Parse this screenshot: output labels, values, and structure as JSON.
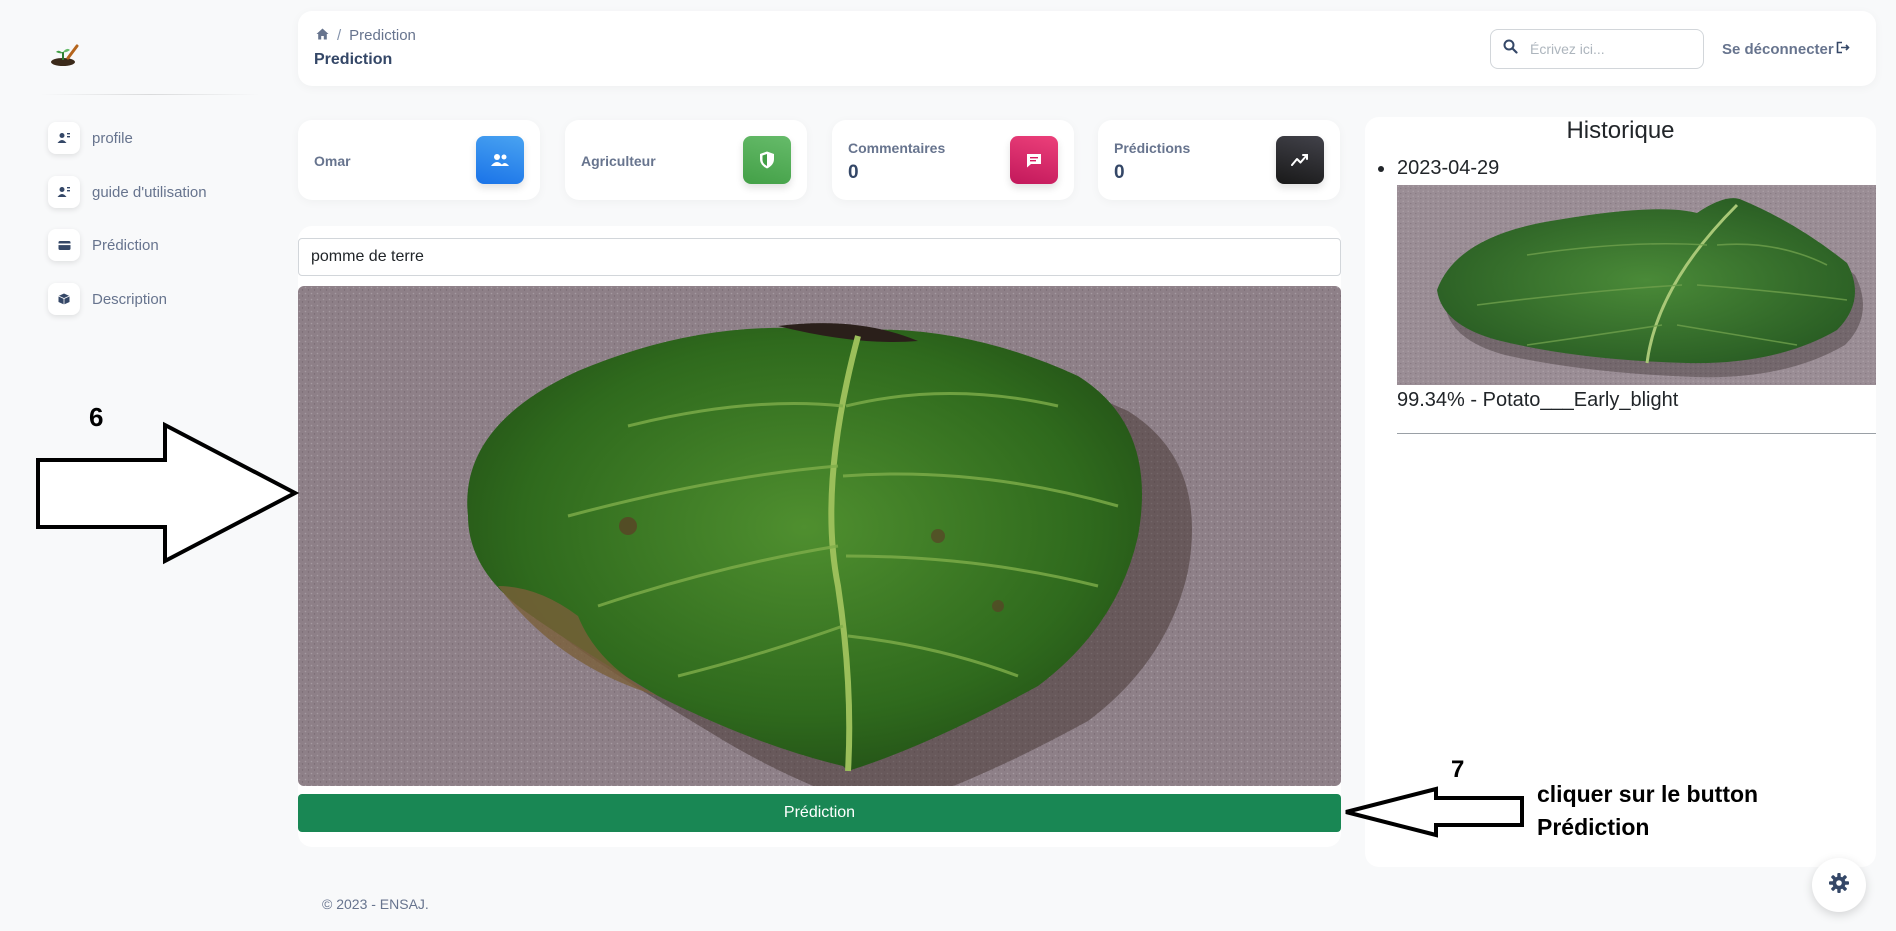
{
  "sidebar": {
    "items": [
      {
        "label": "profile",
        "icon": "user-cog-icon"
      },
      {
        "label": "guide d'utilisation",
        "icon": "user-cog-icon"
      },
      {
        "label": "Prédiction",
        "icon": "credit-card-icon"
      },
      {
        "label": "Description",
        "icon": "box-icon"
      }
    ]
  },
  "header": {
    "breadcrumb_current": "Prediction",
    "title": "Prediction",
    "search_placeholder": "Écrivez ici...",
    "logout_label": "Se déconnecter"
  },
  "cards": [
    {
      "label": "Omar",
      "value": "",
      "icon": "users-icon",
      "color": "#1a73e8"
    },
    {
      "label": "Agriculteur",
      "value": "",
      "icon": "shield-icon",
      "color": "#4caf50"
    },
    {
      "label": "Commentaires",
      "value": "0",
      "icon": "comment-icon",
      "color": "#e91e63"
    },
    {
      "label": "Prédictions",
      "value": "0",
      "icon": "chart-line-icon",
      "color": "#344767"
    }
  ],
  "prediction": {
    "plant_value": "pomme de terre",
    "button_label": "Prédiction"
  },
  "history": {
    "title": "Historique",
    "entries": [
      {
        "date": "2023-04-29",
        "result": "99.34% - Potato___Early_blight"
      }
    ]
  },
  "footer": {
    "text": "© 2023  - ENSAJ."
  },
  "annotations": {
    "step6": "6",
    "step7": "7",
    "instruction_line1": "cliquer sur le button",
    "instruction_line2": "Prédiction"
  },
  "colors": {
    "success": "#198754",
    "text": "#344767",
    "muted": "#67748e"
  }
}
